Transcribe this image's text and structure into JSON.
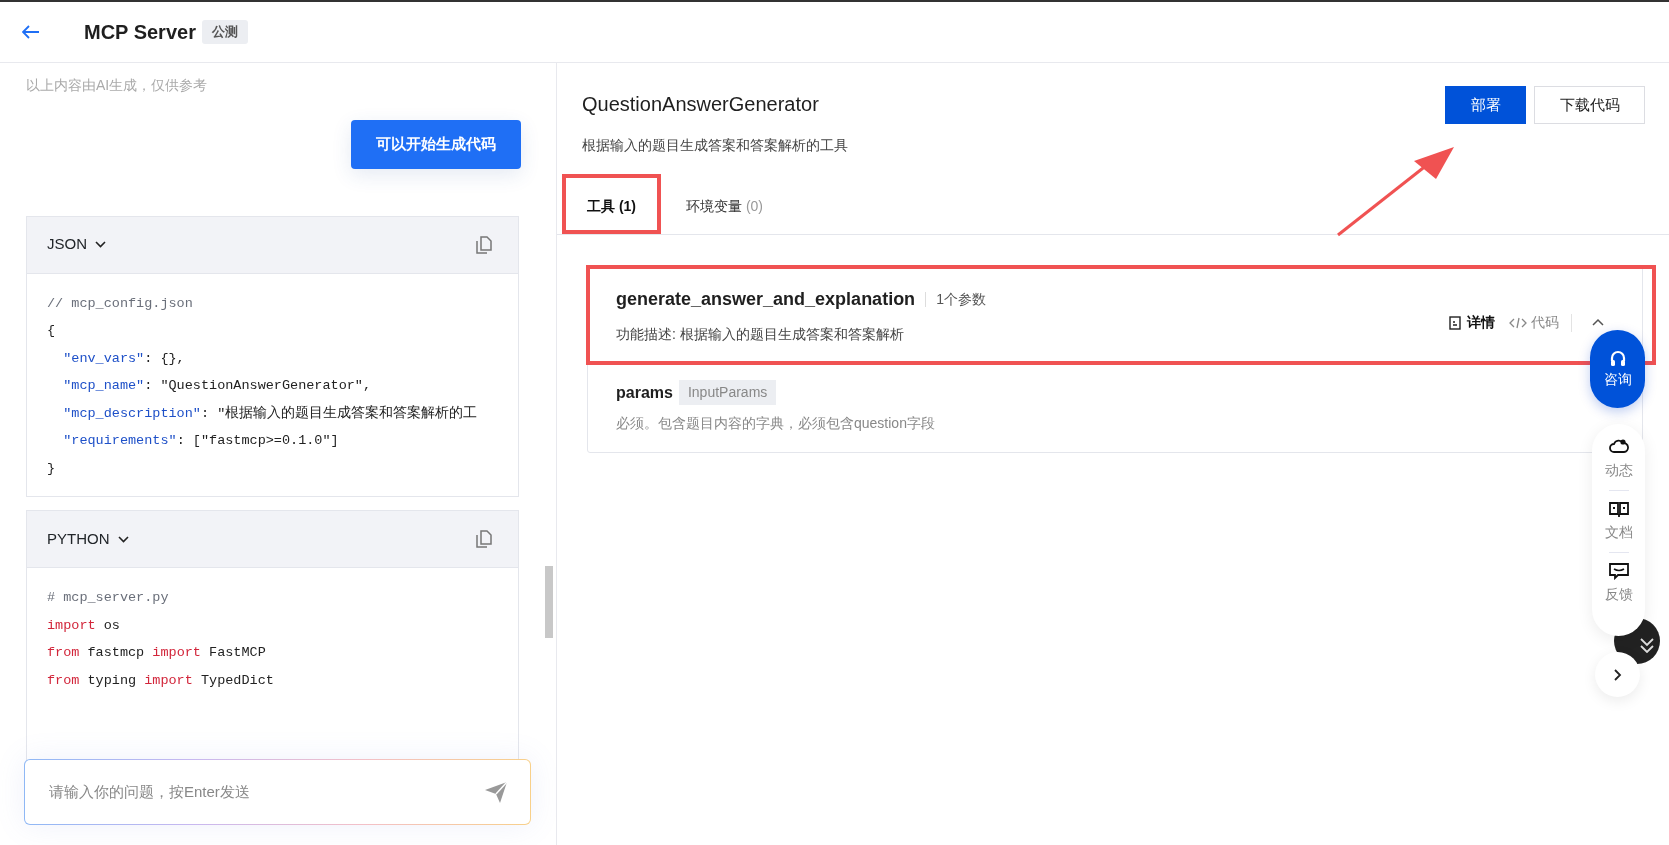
{
  "header": {
    "title": "MCP Server",
    "badge": "公测"
  },
  "chat": {
    "notice": "以上内容由AI生成，仅供参考",
    "action_button": "可以开始生成代码",
    "code_blocks": [
      {
        "language": "JSON",
        "lines": [
          [
            {
              "kind": "comment",
              "text": "// mcp_config.json"
            }
          ],
          [
            {
              "kind": "plain",
              "text": "{"
            }
          ],
          [
            {
              "kind": "key",
              "text": "  \"env_vars\""
            },
            {
              "kind": "plain",
              "text": ": {},"
            }
          ],
          [
            {
              "kind": "key",
              "text": "  \"mcp_name\""
            },
            {
              "kind": "plain",
              "text": ": \"QuestionAnswerGenerator\","
            }
          ],
          [
            {
              "kind": "key",
              "text": "  \"mcp_description\""
            },
            {
              "kind": "plain",
              "text": ": \"根据输入的题目生成答案和答案解析的工"
            }
          ],
          [
            {
              "kind": "key",
              "text": "  \"requirements\""
            },
            {
              "kind": "plain",
              "text": ": [\"fastmcp>=0.1.0\"]"
            }
          ],
          [
            {
              "kind": "plain",
              "text": "}"
            }
          ]
        ]
      },
      {
        "language": "PYTHON",
        "lines": [
          [
            {
              "kind": "comment",
              "text": "# mcp_server.py"
            }
          ],
          [
            {
              "kind": "keyword",
              "text": "import"
            },
            {
              "kind": "plain",
              "text": " os"
            }
          ],
          [
            {
              "kind": "keyword",
              "text": "from"
            },
            {
              "kind": "plain",
              "text": " fastmcp "
            },
            {
              "kind": "keyword",
              "text": "import"
            },
            {
              "kind": "plain",
              "text": " FastMCP"
            }
          ],
          [
            {
              "kind": "keyword",
              "text": "from"
            },
            {
              "kind": "plain",
              "text": " typing "
            },
            {
              "kind": "keyword",
              "text": "import"
            },
            {
              "kind": "plain",
              "text": " TypedDict"
            }
          ]
        ]
      }
    ],
    "input": {
      "placeholder": "请输入你的问题，按Enter发送"
    }
  },
  "server": {
    "name": "QuestionAnswerGenerator",
    "description": "根据输入的题目生成答案和答案解析的工具",
    "buttons": [
      {
        "label": "部署",
        "kind": "primary"
      },
      {
        "label": "下载代码",
        "kind": "outline"
      }
    ],
    "tabs": [
      {
        "label": "工具",
        "count": "(1)",
        "selected": true,
        "highlighted": true
      },
      {
        "label": "环境变量",
        "count": "(0)",
        "selected": false,
        "highlighted": false
      }
    ],
    "tools": [
      {
        "name": "generate_answer_and_explanation",
        "param_count": "1个参数",
        "description": "功能描述: 根据输入的题目生成答案和答案解析",
        "highlighted": true,
        "expanded": true,
        "actions": [
          {
            "label": "详情",
            "kind": "details"
          },
          {
            "label": "代码",
            "kind": "code"
          }
        ],
        "params": [
          {
            "name": "params",
            "type": "InputParams",
            "description": "必须。包含题目内容的字典，必须包含question字段"
          }
        ]
      }
    ]
  },
  "floating": {
    "consult": "咨询",
    "side_items": [
      {
        "label": "动态",
        "kind": "cloud"
      },
      {
        "label": "文档",
        "kind": "book"
      },
      {
        "label": "反馈",
        "kind": "feedback"
      }
    ]
  }
}
